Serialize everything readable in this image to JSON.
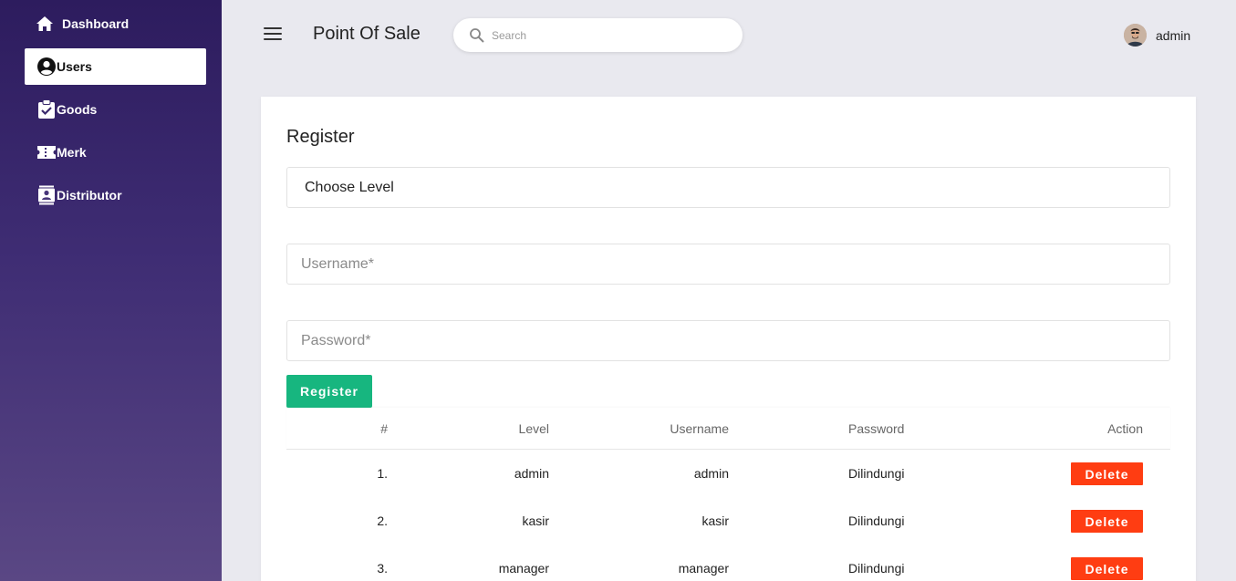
{
  "sidebar": {
    "items": [
      {
        "label": "Dashboard",
        "icon": "home-icon"
      },
      {
        "label": "Users",
        "icon": "user-circle-icon",
        "active": true
      },
      {
        "label": "Goods",
        "icon": "clipboard-check-icon"
      },
      {
        "label": "Merk",
        "icon": "ticket-icon"
      },
      {
        "label": "Distributor",
        "icon": "contact-card-icon"
      }
    ]
  },
  "header": {
    "title": "Point Of Sale",
    "search_placeholder": "Search",
    "user_name": "admin"
  },
  "form": {
    "title": "Register",
    "level_select": "Choose Level",
    "username_placeholder": "Username*",
    "password_placeholder": "Password*",
    "submit_label": "Register"
  },
  "table": {
    "headers": [
      "#",
      "Level",
      "Username",
      "Password",
      "Action"
    ],
    "rows": [
      {
        "no": "1.",
        "level": "admin",
        "username": "admin",
        "password": "Dilindungi",
        "action": "Delete"
      },
      {
        "no": "2.",
        "level": "kasir",
        "username": "kasir",
        "password": "Dilindungi",
        "action": "Delete"
      },
      {
        "no": "3.",
        "level": "manager",
        "username": "manager",
        "password": "Dilindungi",
        "action": "Delete"
      }
    ]
  },
  "colors": {
    "sidebar_top": "#2d1c5e",
    "sidebar_bottom": "#5a4784",
    "register_button": "#17b67f",
    "delete_button": "#ff3d12"
  }
}
